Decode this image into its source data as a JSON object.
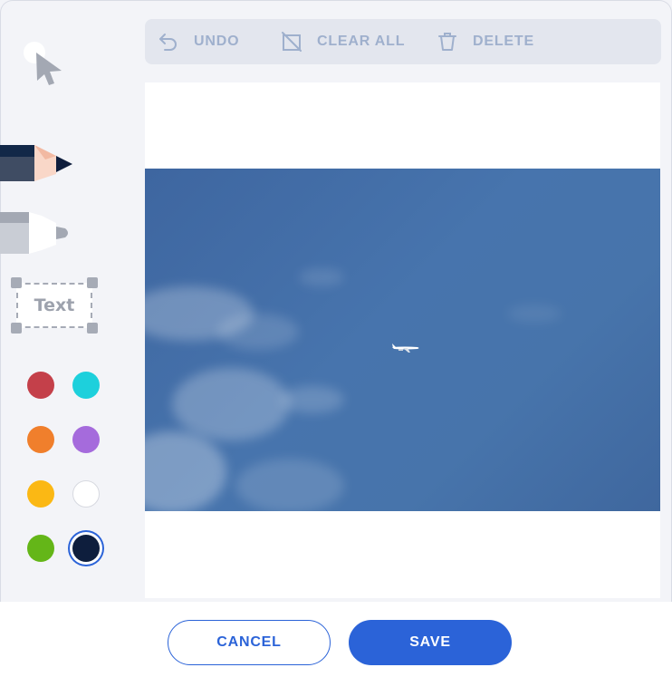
{
  "toolbar": {
    "undo_label": "UNDO",
    "clear_all_label": "CLEAR ALL",
    "delete_label": "DELETE"
  },
  "tools": {
    "text_label": "Text"
  },
  "colors": [
    {
      "name": "red",
      "hex": "#c4404a"
    },
    {
      "name": "cyan",
      "hex": "#1dd0dc"
    },
    {
      "name": "orange",
      "hex": "#f07f2c"
    },
    {
      "name": "purple",
      "hex": "#a56bdc"
    },
    {
      "name": "yellow",
      "hex": "#fbb814"
    },
    {
      "name": "white",
      "hex": "#ffffff"
    },
    {
      "name": "green",
      "hex": "#64b618"
    },
    {
      "name": "navy",
      "hex": "#0e1e3d",
      "selected": true
    }
  ],
  "accent": "#2b63d8",
  "footer": {
    "cancel_label": "CANCEL",
    "save_label": "SAVE"
  }
}
